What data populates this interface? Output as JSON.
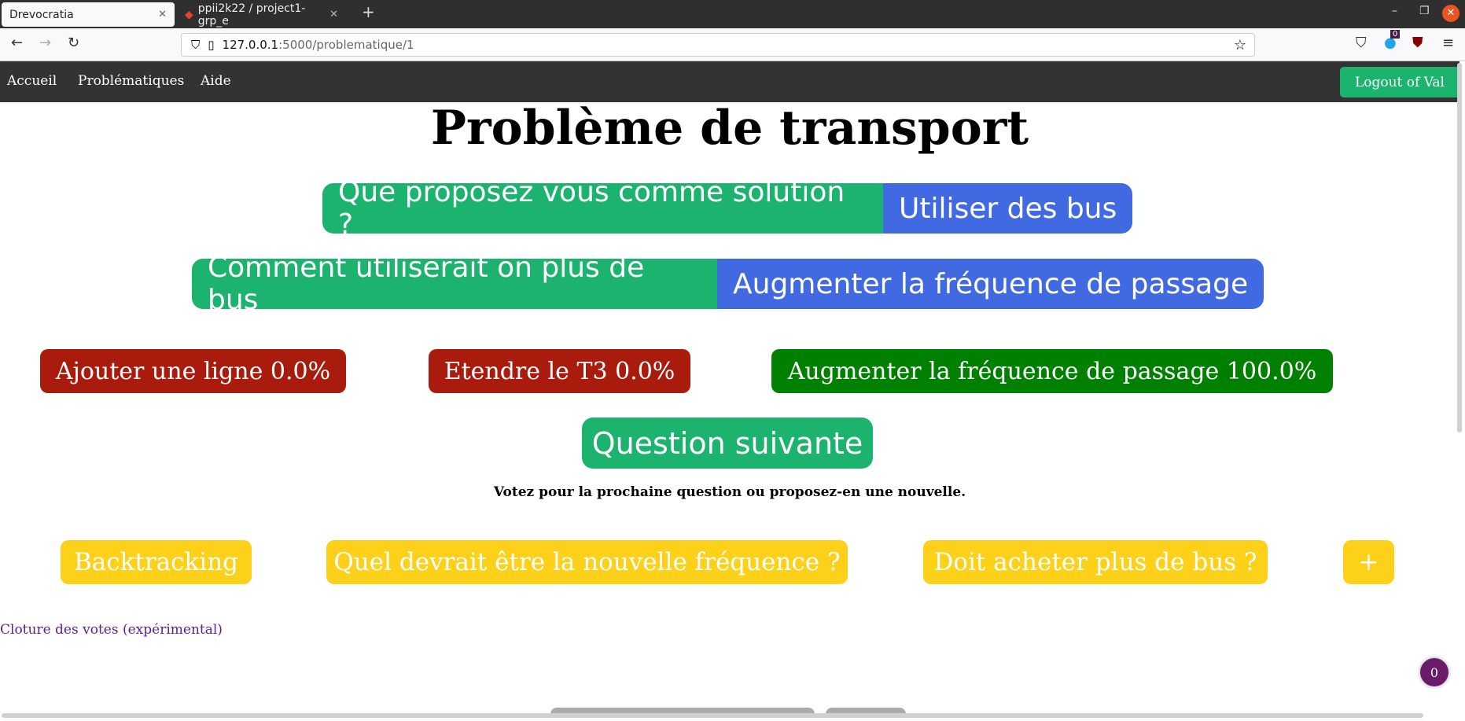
{
  "browser": {
    "tabs": [
      {
        "title": "Drevocratia",
        "active": true
      },
      {
        "title": "ppii2k22 / project1-grp_e",
        "active": false
      }
    ],
    "url_host": "127.0.0.1",
    "url_path": ":5000/problematique/1",
    "ext_badge": "0"
  },
  "nav": {
    "links": [
      "Accueil",
      "Problématiques",
      "Aide"
    ],
    "logout": "Logout of Val"
  },
  "title": "Problème de transport",
  "path": [
    {
      "question": "Que proposez vous comme solution ?",
      "answer": "Utiliser des bus"
    },
    {
      "question": "Comment utiliserait on plus de bus",
      "answer": "Augmenter la fréquence de passage"
    }
  ],
  "answers": [
    {
      "label": "Ajouter une ligne 0.0%",
      "percent": 0.0,
      "color": "#a91b0d"
    },
    {
      "label": "Etendre le T3 0.0%",
      "percent": 0.0,
      "color": "#a91b0d"
    },
    {
      "label": "Augmenter la fréquence de passage 100.0%",
      "percent": 100.0,
      "color": "#008000"
    }
  ],
  "next_label": "Question suivante",
  "vote_text": "Votez pour la prochaine question ou proposez-en une nouvelle.",
  "next_questions": [
    "Backtracking",
    "Quel devrait être la nouvelle fréquence ?",
    "Doit acheter plus de bus ?",
    "+"
  ],
  "cloture": "Cloture des votes (expérimental)",
  "badge": "0"
}
